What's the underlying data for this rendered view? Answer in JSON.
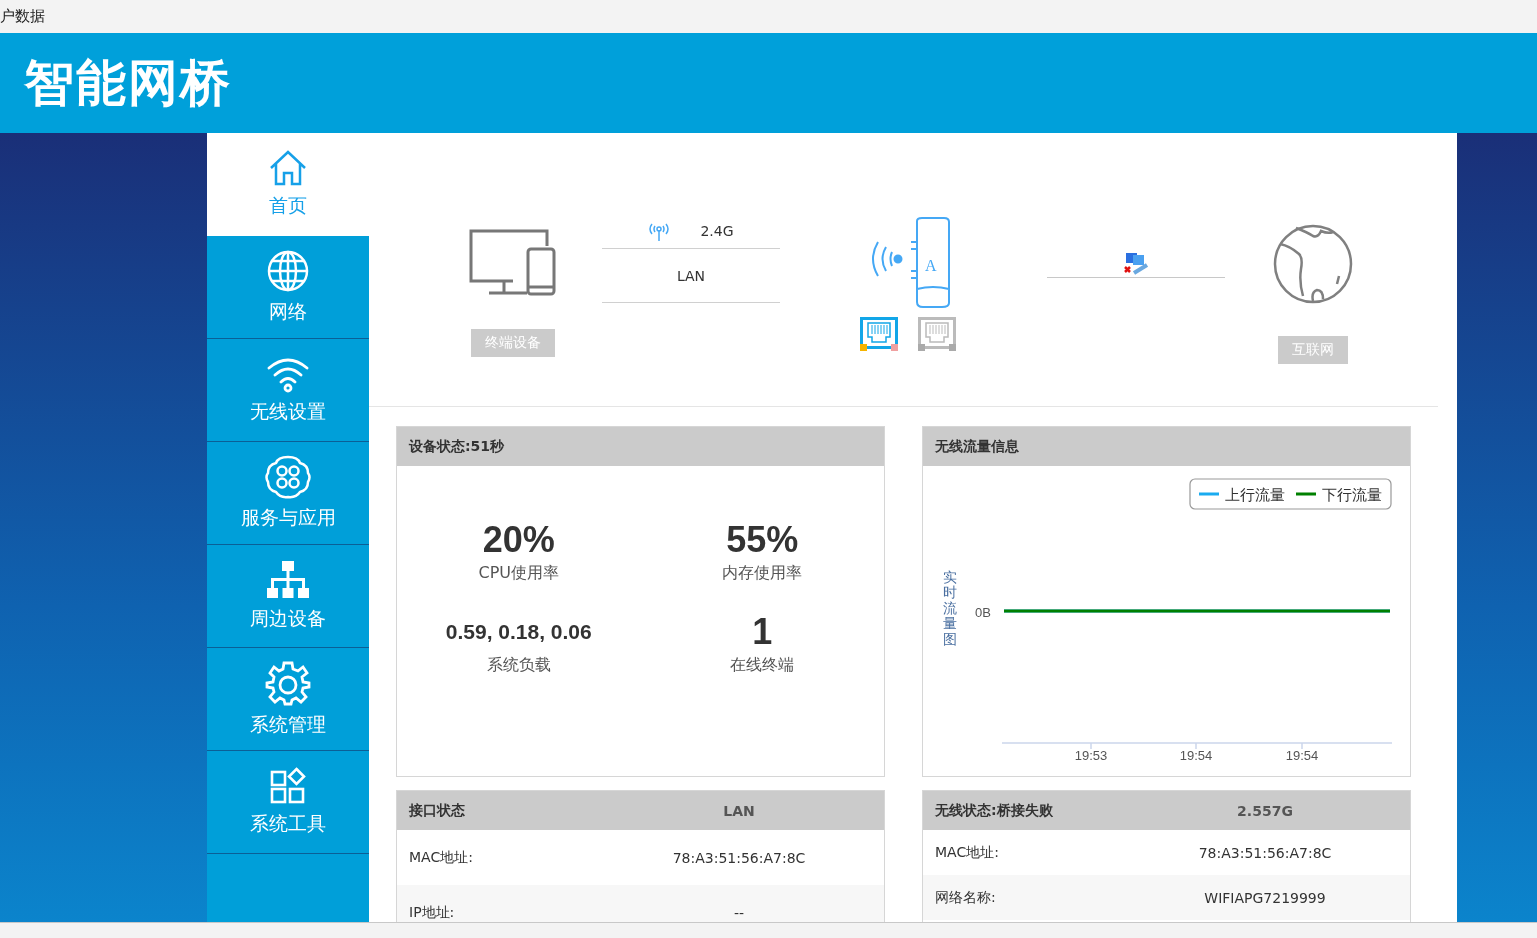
{
  "window": {
    "title": "户数据"
  },
  "header": {
    "logo": "智能网桥"
  },
  "sidebar": {
    "items": [
      {
        "label": "首页",
        "selected": true
      },
      {
        "label": "网络",
        "selected": false
      },
      {
        "label": "无线设置",
        "selected": false
      },
      {
        "label": "服务与应用",
        "selected": false
      },
      {
        "label": "周边设备",
        "selected": false
      },
      {
        "label": "系统管理",
        "selected": false
      },
      {
        "label": "系统工具",
        "selected": false
      }
    ]
  },
  "topology": {
    "terminal_label": "终端设备",
    "band": "2.4G",
    "link": "LAN",
    "device_letter": "A",
    "ports": [
      {
        "active": true
      },
      {
        "active": false
      }
    ],
    "internet_label": "互联网"
  },
  "device_status": {
    "title": "设备状态:51秒",
    "stats": [
      {
        "value": "20%",
        "label": "CPU使用率",
        "kind": "large"
      },
      {
        "value": "55%",
        "label": "内存使用率",
        "kind": "large"
      },
      {
        "value": "0.59, 0.18, 0.06",
        "label": "系统负载",
        "kind": "small"
      },
      {
        "value": "1",
        "label": "在线终端",
        "kind": "large"
      }
    ]
  },
  "traffic": {
    "title": "无线流量信息",
    "ylabel": "实时流量图",
    "y_tick": "0B",
    "x_labels": [
      "19:53",
      "19:54",
      "19:54"
    ],
    "legend": [
      {
        "name": "上行流量",
        "color": "#1aabf0"
      },
      {
        "name": "下行流量",
        "color": "#008000"
      }
    ]
  },
  "interface_status": {
    "title": "接口状态",
    "column": "LAN",
    "rows": [
      {
        "label": "MAC地址:",
        "value": "78:A3:51:56:A7:8C"
      },
      {
        "label": "IP地址:",
        "value": "--"
      }
    ]
  },
  "wireless_status": {
    "title": "无线状态:桥接失败",
    "column": "2.557G",
    "rows": [
      {
        "label": "MAC地址:",
        "value": "78:A3:51:56:A7:8C"
      },
      {
        "label": "网络名称:",
        "value": "WIFIAPG7219999"
      }
    ]
  }
}
